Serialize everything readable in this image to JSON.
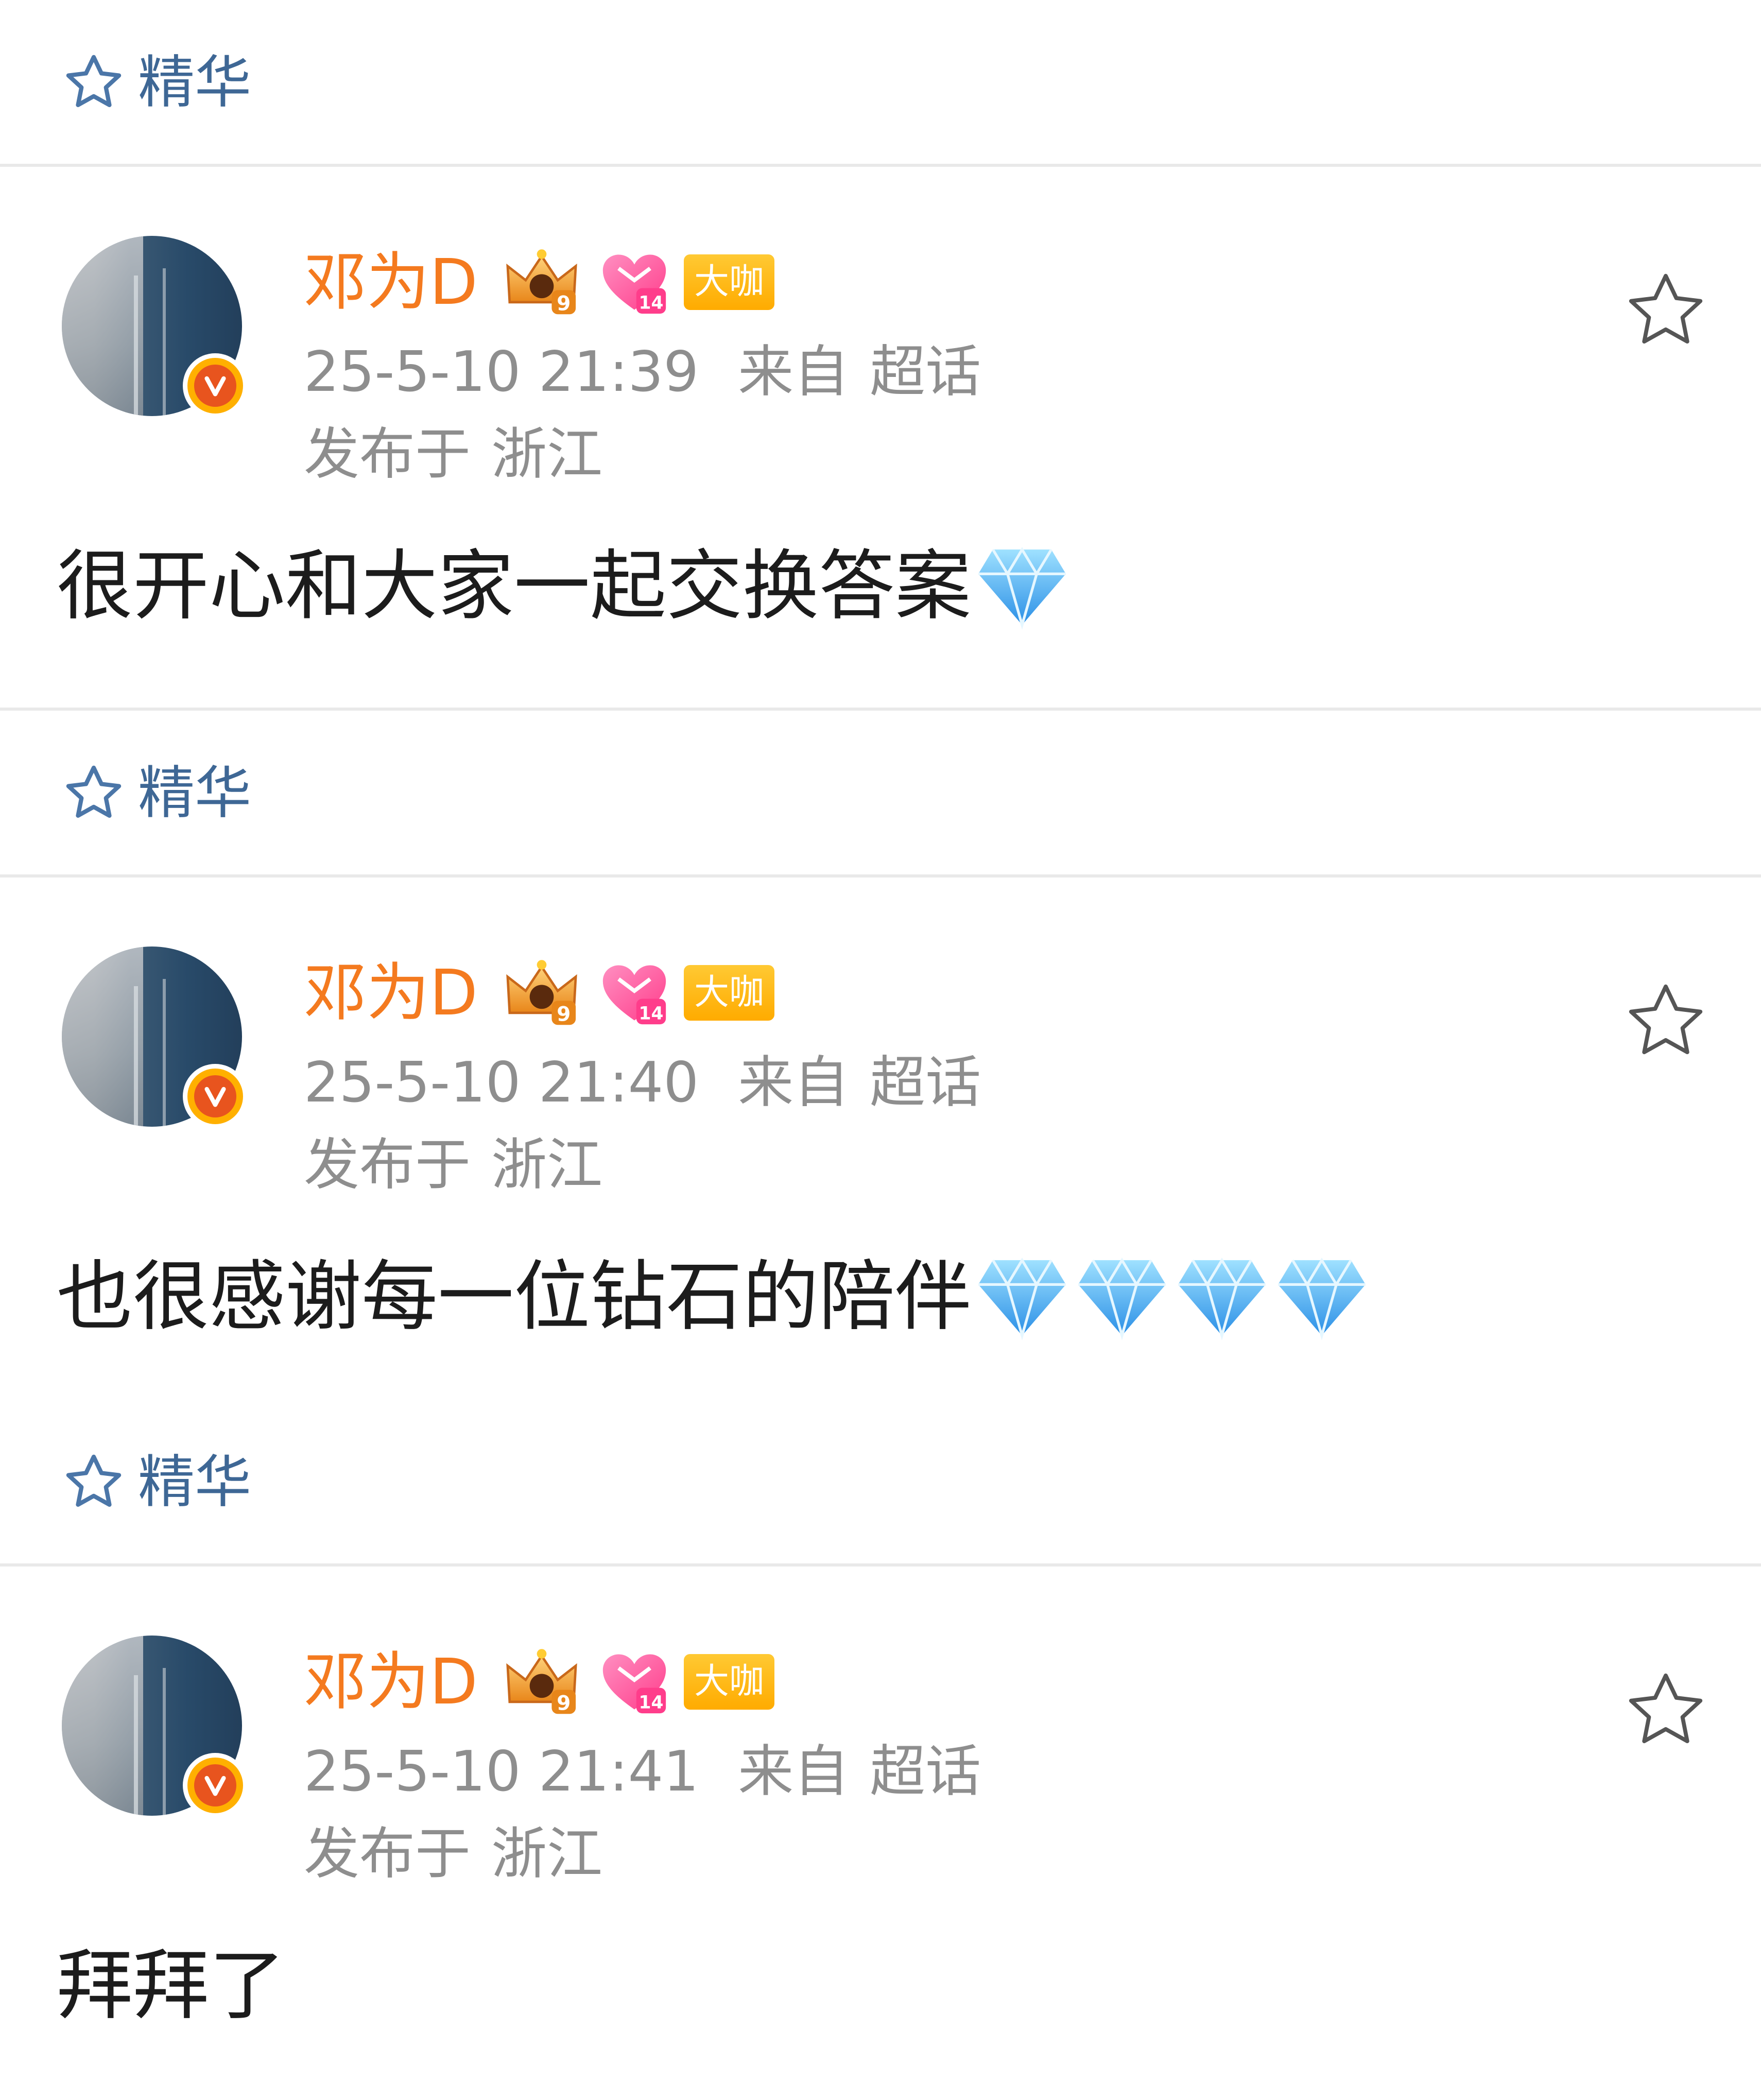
{
  "essence_label": "精华",
  "colors": {
    "username": "#f47a1f",
    "essence": "#3e6795",
    "meta": "#8e8e8e",
    "divider": "#e9e9e9",
    "badge_orange": "#ffb000"
  },
  "posts": [
    {
      "username": "邓为D",
      "badge_level_crown": "9",
      "badge_level_heart": "14",
      "badge_tag": "大咖",
      "time": "25-5-10 21:39",
      "source_prefix": "来自",
      "source": "超话",
      "location_prefix": "发布于",
      "location": "浙江",
      "text": "很开心和大家一起交换答案",
      "gem_count": 1
    },
    {
      "username": "邓为D",
      "badge_level_crown": "9",
      "badge_level_heart": "14",
      "badge_tag": "大咖",
      "time": "25-5-10 21:40",
      "source_prefix": "来自",
      "source": "超话",
      "location_prefix": "发布于",
      "location": "浙江",
      "text": "也很感谢每一位钻石的陪伴",
      "gem_count": 4
    },
    {
      "username": "邓为D",
      "badge_level_crown": "9",
      "badge_level_heart": "14",
      "badge_tag": "大咖",
      "time": "25-5-10 21:41",
      "source_prefix": "来自",
      "source": "超话",
      "location_prefix": "发布于",
      "location": "浙江",
      "text": "拜拜了",
      "gem_count": 0
    }
  ]
}
